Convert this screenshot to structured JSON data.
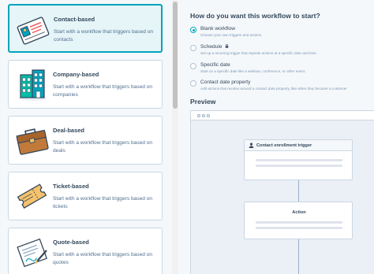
{
  "workflow_types": [
    {
      "title": "Contact-based",
      "description": "Start with a workflow that triggers based on contacts",
      "illustration": "contact-card-icon",
      "selected": true
    },
    {
      "title": "Company-based",
      "description": "Start with a workflow that triggers based on companies",
      "illustration": "building-icon",
      "selected": false
    },
    {
      "title": "Deal-based",
      "description": "Start with a workflow that triggers based on deals",
      "illustration": "briefcase-icon",
      "selected": false
    },
    {
      "title": "Ticket-based",
      "description": "Start with a workflow that triggers based on tickets",
      "illustration": "ticket-icon",
      "selected": false
    },
    {
      "title": "Quote-based",
      "description": "Start with a workflow that triggers based on quotes",
      "illustration": "quote-document-icon",
      "selected": false
    }
  ],
  "start_options": {
    "heading": "How do you want this workflow to start?",
    "options": [
      {
        "label": "Blank workflow",
        "description": "Choose your own triggers and actions.",
        "checked": true,
        "locked": false
      },
      {
        "label": "Schedule",
        "description": "Set up a recurring trigger that repeats actions at a specific date and time.",
        "checked": false,
        "locked": true
      },
      {
        "label": "Specific date",
        "description": "Start on a specific date like a webinar, conference, or other event.",
        "checked": false,
        "locked": false
      },
      {
        "label": "Contact date property",
        "description": "Add actions that revolve around a contact date property, like when they became a customer",
        "checked": false,
        "locked": false
      }
    ]
  },
  "preview": {
    "heading": "Preview",
    "trigger_label": "Contact enrollment trigger",
    "action_label": "Action"
  },
  "colors": {
    "accent": "#00a4bd",
    "text": "#33475b",
    "border": "#cbd6e2",
    "panel_bg": "#f5f8fa"
  }
}
